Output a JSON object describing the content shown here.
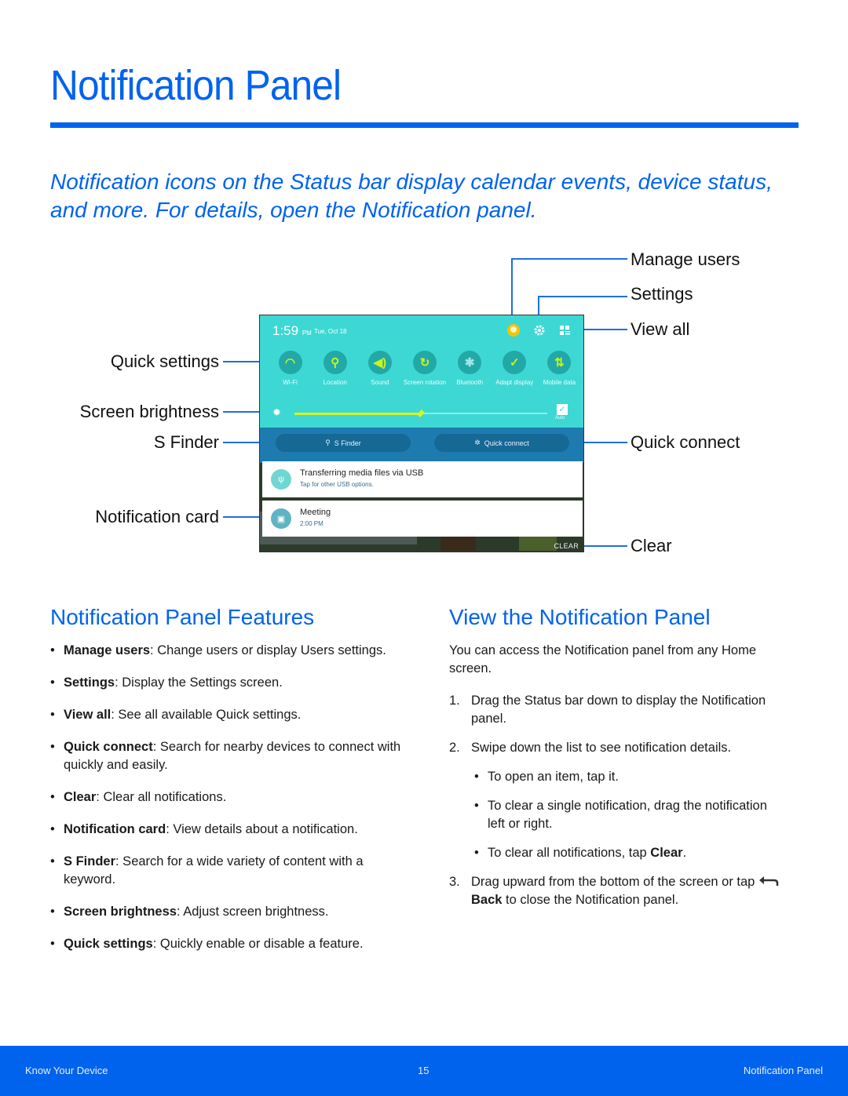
{
  "page": {
    "title": "Notification Panel",
    "intro": "Notification icons on the Status bar display calendar events, device status, and more. For details, open the Notification panel."
  },
  "figure": {
    "callouts": {
      "manage_users": "Manage users",
      "settings": "Settings",
      "view_all": "View all",
      "quick_settings": "Quick settings",
      "screen_brightness": "Screen brightness",
      "s_finder": "S Finder",
      "quick_connect": "Quick connect",
      "notification_card": "Notification card",
      "clear": "Clear"
    },
    "panel": {
      "time": "1:59",
      "ampm": "PM",
      "date": "Tue, Oct 18",
      "top_icons": [
        "user-avatar-icon",
        "gear-icon",
        "grid-icon"
      ],
      "tiles": [
        {
          "icon": "wifi-icon",
          "glyph": "◠",
          "label": "Wi-Fi"
        },
        {
          "icon": "location-icon",
          "glyph": "⚲",
          "label": "Location"
        },
        {
          "icon": "sound-icon",
          "glyph": "◀)",
          "label": "Sound"
        },
        {
          "icon": "screen-rotation-icon",
          "glyph": "↻",
          "label": "Screen rotation"
        },
        {
          "icon": "bluetooth-icon",
          "glyph": "✱",
          "label": "Bluetooth"
        },
        {
          "icon": "adapt-display-icon",
          "glyph": "✓",
          "label": "Adapt display"
        },
        {
          "icon": "mobile-data-icon",
          "glyph": "⇅",
          "label": "Mobile data"
        }
      ],
      "brightness_level": 0.5,
      "brightness_auto_label": "Auto",
      "brightness_auto_checked": true,
      "s_finder_label": "S Finder",
      "quick_connect_label": "Quick connect",
      "notifications": [
        {
          "icon": "usb-icon",
          "glyph": "ψ",
          "title": "Transferring media files via USB",
          "subtitle": "Tap for other USB options."
        },
        {
          "icon": "calendar-icon",
          "glyph": "▣",
          "title": "Meeting",
          "subtitle": "2:00 PM"
        }
      ],
      "clear_label": "CLEAR"
    }
  },
  "features": {
    "heading": "Notification Panel Features",
    "items": [
      {
        "term": "Manage users",
        "desc": ": Change users or display Users settings."
      },
      {
        "term": "Settings",
        "desc": ": Display the Settings screen."
      },
      {
        "term": "View all",
        "desc": ": See all available Quick settings."
      },
      {
        "term": "Quick connect",
        "desc": ": Search for nearby devices to connect with quickly and easily."
      },
      {
        "term": "Clear",
        "desc": ": Clear all notifications."
      },
      {
        "term": "Notification card",
        "desc": ": View details about a notification."
      },
      {
        "term": "S Finder",
        "desc": ": Search for a wide variety of content with a keyword."
      },
      {
        "term": "Screen brightness",
        "desc": ": Adjust screen brightness."
      },
      {
        "term": "Quick settings",
        "desc": ": Quickly enable or disable a feature."
      }
    ]
  },
  "view": {
    "heading": "View the Notification Panel",
    "intro": "You can access the Notification panel from any Home screen.",
    "steps": [
      {
        "n": "1.",
        "text": "Drag the Status bar down to display the Notification panel."
      },
      {
        "n": "2.",
        "text": "Swipe down the list to see notification details."
      },
      {
        "n": "3.",
        "text_before": "Drag upward from the bottom of the screen or tap ",
        "bold": "Back",
        "text_after": " to close the Notification panel."
      }
    ],
    "sub_bullets": [
      {
        "text": "To open an item, tap it."
      },
      {
        "text": "To clear a single notification, drag the notification left or right."
      },
      {
        "text_before": "To clear all notifications, tap ",
        "bold": "Clear",
        "text_after": "."
      }
    ]
  },
  "footer": {
    "left": "Know Your Device",
    "page_number": "15",
    "right": "Notification Panel"
  }
}
